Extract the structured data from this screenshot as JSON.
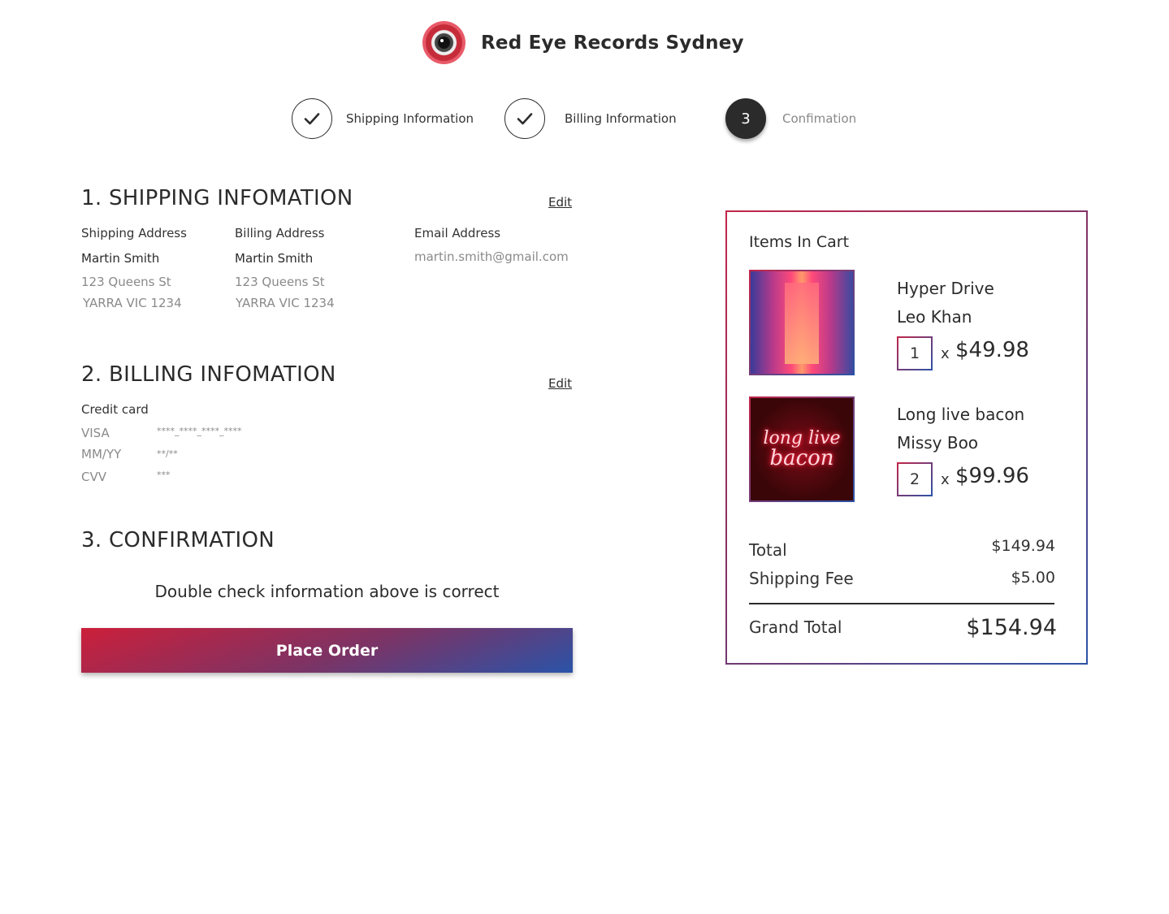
{
  "header": {
    "brand": "Red Eye Records Sydney",
    "logo_icon": "eye-icon"
  },
  "steps": [
    {
      "label": "Shipping Information",
      "state": "done",
      "icon": "check-icon"
    },
    {
      "label": "Billing Information",
      "state": "done",
      "icon": "check-icon"
    },
    {
      "label": "Confimation",
      "state": "active",
      "number": "3"
    }
  ],
  "shipping": {
    "title": "1. SHIPPING INFOMATION",
    "edit": "Edit",
    "shipping_address": {
      "label": "Shipping Address",
      "name": "Martin Smith",
      "street": "123 Queens St",
      "city": "YARRA VIC 1234"
    },
    "billing_address": {
      "label": "Billing Address",
      "name": "Martin Smith",
      "street": "123 Queens St",
      "city": "YARRA VIC 1234"
    },
    "email": {
      "label": "Email Address",
      "value": "martin.smith@gmail.com"
    }
  },
  "billing": {
    "title": "2. BILLING INFOMATION",
    "edit": "Edit",
    "method": "Credit card",
    "rows": [
      {
        "label": "VISA",
        "value": "****_****_****_****"
      },
      {
        "label": "MM/YY",
        "value": "**/**"
      },
      {
        "label": "CVV",
        "value": "***"
      }
    ]
  },
  "confirmation": {
    "title": "3. CONFIRMATION",
    "note": "Double check information above is correct",
    "button": "Place Order"
  },
  "cart": {
    "title": "Items In Cart",
    "items": [
      {
        "title": "Hyper Drive",
        "artist": "Leo Khan",
        "qty": "1",
        "times": "x",
        "price": "$49.98"
      },
      {
        "title": "Long live bacon",
        "artist": "Missy Boo",
        "qty": "2",
        "times": "x",
        "price": "$99.96",
        "art_text_1": "long live",
        "art_text_2": "bacon"
      }
    ],
    "total_label": "Total",
    "total": "$149.94",
    "shipping_label": "Shipping Fee",
    "shipping": "$5.00",
    "grand_label": "Grand Total",
    "grand_total": "$154.94"
  },
  "colors": {
    "accent_red": "#cc1f3a",
    "accent_blue": "#2a53a8",
    "text_dark": "#2b2b2b",
    "muted": "#8a8a8a"
  }
}
